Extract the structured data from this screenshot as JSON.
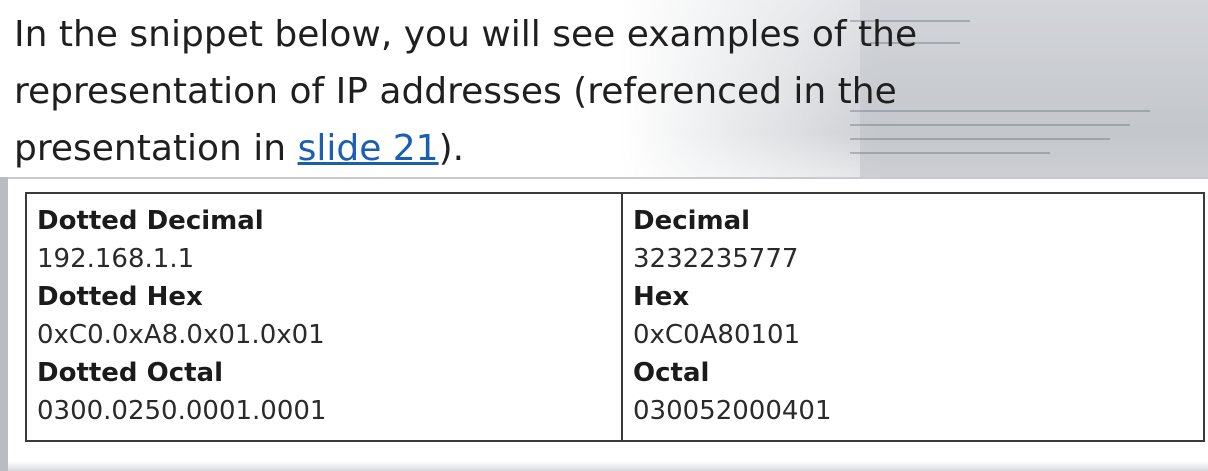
{
  "intro": {
    "text_before": "In the snippet below, you will see examples of the representation of IP addresses (referenced in the presentation in ",
    "link_text": "slide 21",
    "text_after": ")."
  },
  "table": {
    "left": [
      {
        "label": "Dotted Decimal",
        "value": "192.168.1.1"
      },
      {
        "label": "Dotted Hex",
        "value": "0xC0.0xA8.0x01.0x01"
      },
      {
        "label": "Dotted Octal",
        "value": "0300.0250.0001.0001"
      }
    ],
    "right": [
      {
        "label": "Decimal",
        "value": "3232235777"
      },
      {
        "label": "Hex",
        "value": "0xC0A80101"
      },
      {
        "label": "Octal",
        "value": "030052000401"
      }
    ]
  },
  "colors": {
    "link": "#1a5fb4",
    "table_border": "#3a3a3a",
    "snippet_left_bar": "#b9bcc2"
  }
}
